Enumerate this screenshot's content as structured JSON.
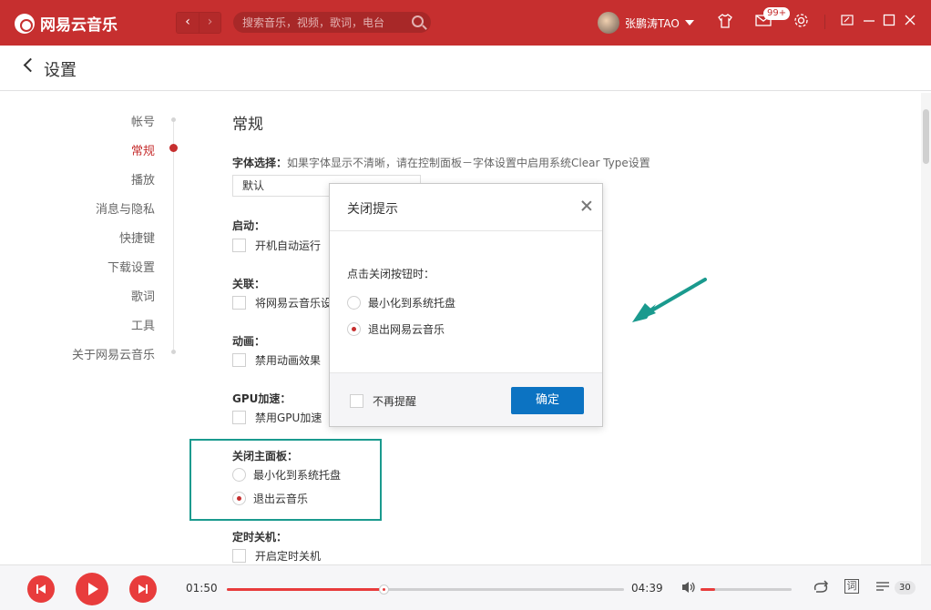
{
  "app": {
    "name": "网易云音乐"
  },
  "topbar": {
    "back": "‹",
    "forward": "›",
    "search_placeholder": "搜索音乐，视频，歌词，电台",
    "username": "张鹏涛TAO",
    "message_badge": "99+"
  },
  "header": {
    "title": "设置"
  },
  "nav": {
    "items": [
      {
        "label": "帐号",
        "active": false
      },
      {
        "label": "常规",
        "active": true
      },
      {
        "label": "播放",
        "active": false
      },
      {
        "label": "消息与隐私",
        "active": false
      },
      {
        "label": "快捷键",
        "active": false
      },
      {
        "label": "下载设置",
        "active": false
      },
      {
        "label": "歌词",
        "active": false
      },
      {
        "label": "工具",
        "active": false
      },
      {
        "label": "关于网易云音乐",
        "active": false
      }
    ]
  },
  "settings": {
    "section_title": "常规",
    "font_label": "字体选择：",
    "font_desc": "如果字体显示不清晰，请在控制面板－字体设置中启用系统Clear Type设置",
    "font_value": "默认",
    "startup_label": "启动：",
    "startup_option": "开机自动运行",
    "assoc_label": "关联：",
    "assoc_option": "将网易云音乐设",
    "anim_label": "动画：",
    "anim_option": "禁用动画效果",
    "gpu_label": "GPU加速：",
    "gpu_option": "禁用GPU加速",
    "close_label": "关闭主面板：",
    "close_opt_minimize": "最小化到系统托盘",
    "close_opt_exit": "退出云音乐",
    "timer_label": "定时关机：",
    "timer_option": "开启定时关机"
  },
  "dialog": {
    "title": "关闭提示",
    "prompt": "点击关闭按钮时：",
    "opt_minimize": "最小化到系统托盘",
    "opt_exit": "退出网易云音乐",
    "dont_remind": "不再提醒",
    "ok": "确定"
  },
  "player": {
    "current_time": "01:50",
    "total_time": "04:39",
    "progress_fraction": 0.395,
    "volume_fraction": 0.16,
    "lyrics_icon": "词",
    "playlist_count": "30"
  },
  "colors": {
    "brand": "#c62f2f",
    "accent_blue": "#0c73c2",
    "annotation": "#1a9a8e"
  }
}
